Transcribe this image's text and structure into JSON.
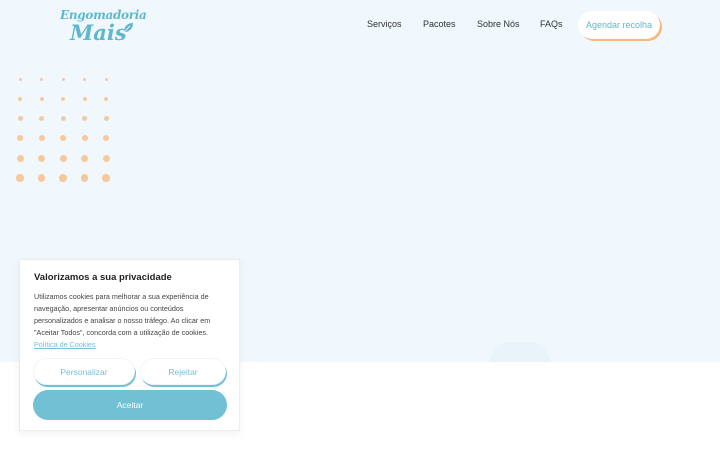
{
  "header": {
    "logo_line1": "Engomadoria",
    "logo_line2": "Mais",
    "nav": [
      "Serviços",
      "Pacotes",
      "Sobre Nós",
      "FAQs"
    ],
    "cta_label": "Agendar recolha"
  },
  "cookie_banner": {
    "title": "Valorizamos a sua privacidade",
    "body": "Utilizamos cookies para melhorar a sua experiência de navegação, apresentar anúncios ou conteúdos personalizados e analisar o nosso tráfego. Ao clicar em \"Aceitar Todos\", concorda com a utilização de cookies.",
    "policy_link": "Política de Cookies",
    "customize_label": "Personalizar",
    "reject_label": "Rejeitar",
    "accept_label": "Aceitar"
  },
  "colors": {
    "accent": "#72c0d3",
    "orange": "#f5b97b",
    "hero_bg": "#f1f8fd"
  },
  "icons": [
    "leaf-icon",
    "dot-pattern"
  ]
}
